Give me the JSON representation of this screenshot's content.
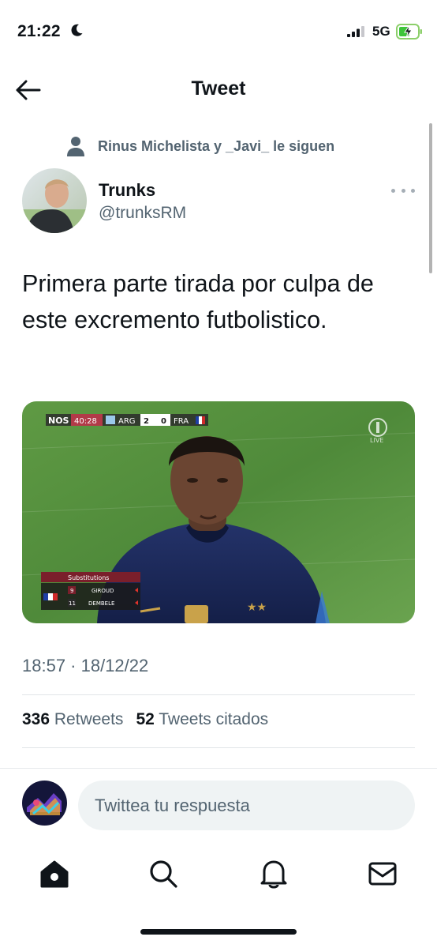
{
  "status_bar": {
    "time": "21:22",
    "network": "5G"
  },
  "header": {
    "title": "Tweet"
  },
  "social_context": {
    "text": "Rinus Michelista y _Javi_ le siguen"
  },
  "author": {
    "name": "Trunks",
    "handle": "@trunksRM"
  },
  "tweet": {
    "text": "Primera parte tirada por culpa de este excremento futbolistico.",
    "timestamp": "18:57 · 18/12/22",
    "retweets_count": "336",
    "retweets_label": "Retweets",
    "quotes_count": "52",
    "quotes_label": "Tweets citados"
  },
  "media": {
    "scorebug": {
      "broadcaster": "NOS",
      "clock": "40:28",
      "home_team": "ARG",
      "home_score": "2",
      "away_score": "0",
      "away_team": "FRA"
    },
    "channel_badge": "LIVE",
    "substitutions": {
      "title": "Substitutions",
      "out_number": "9",
      "out_player": "GIROUD",
      "in_number": "11",
      "in_player": "DEMBELE"
    }
  },
  "reply": {
    "placeholder": "Twittea tu respuesta"
  },
  "tabs": [
    "home",
    "search",
    "notifications",
    "messages"
  ],
  "colors": {
    "text": "#0f1419",
    "secondary": "#536471",
    "input_bg": "#eff3f4",
    "pitch": "#4f8a3a",
    "kit": "#1c2a5c"
  }
}
